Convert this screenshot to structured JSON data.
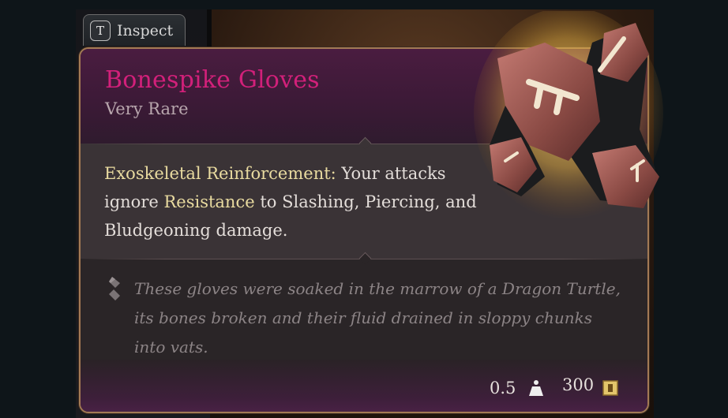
{
  "prompt": {
    "key": "T",
    "label": "Inspect"
  },
  "item": {
    "name": "Bonespike Gloves",
    "rarity": "Very Rare",
    "ability_name": "Exoskeletal Reinforcement:",
    "ability_text_1": " Your attacks ignore ",
    "ability_link": "Resistance",
    "ability_text_2": " to Slashing, Piercing, and Bludgeoning damage.",
    "flavor": "These gloves were soaked in the marrow of a Dragon Turtle, its bones broken and their fluid drained in sloppy chunks into vats.",
    "weight": "0.5",
    "price": "300"
  },
  "colors": {
    "name": "#d2207a",
    "border": "#a37a55",
    "keyword": "#e9dba0"
  },
  "icons": {
    "weight": "weight-icon",
    "price": "gold-coin-icon",
    "flavor": "quill-icon",
    "item": "gloves-icon"
  }
}
